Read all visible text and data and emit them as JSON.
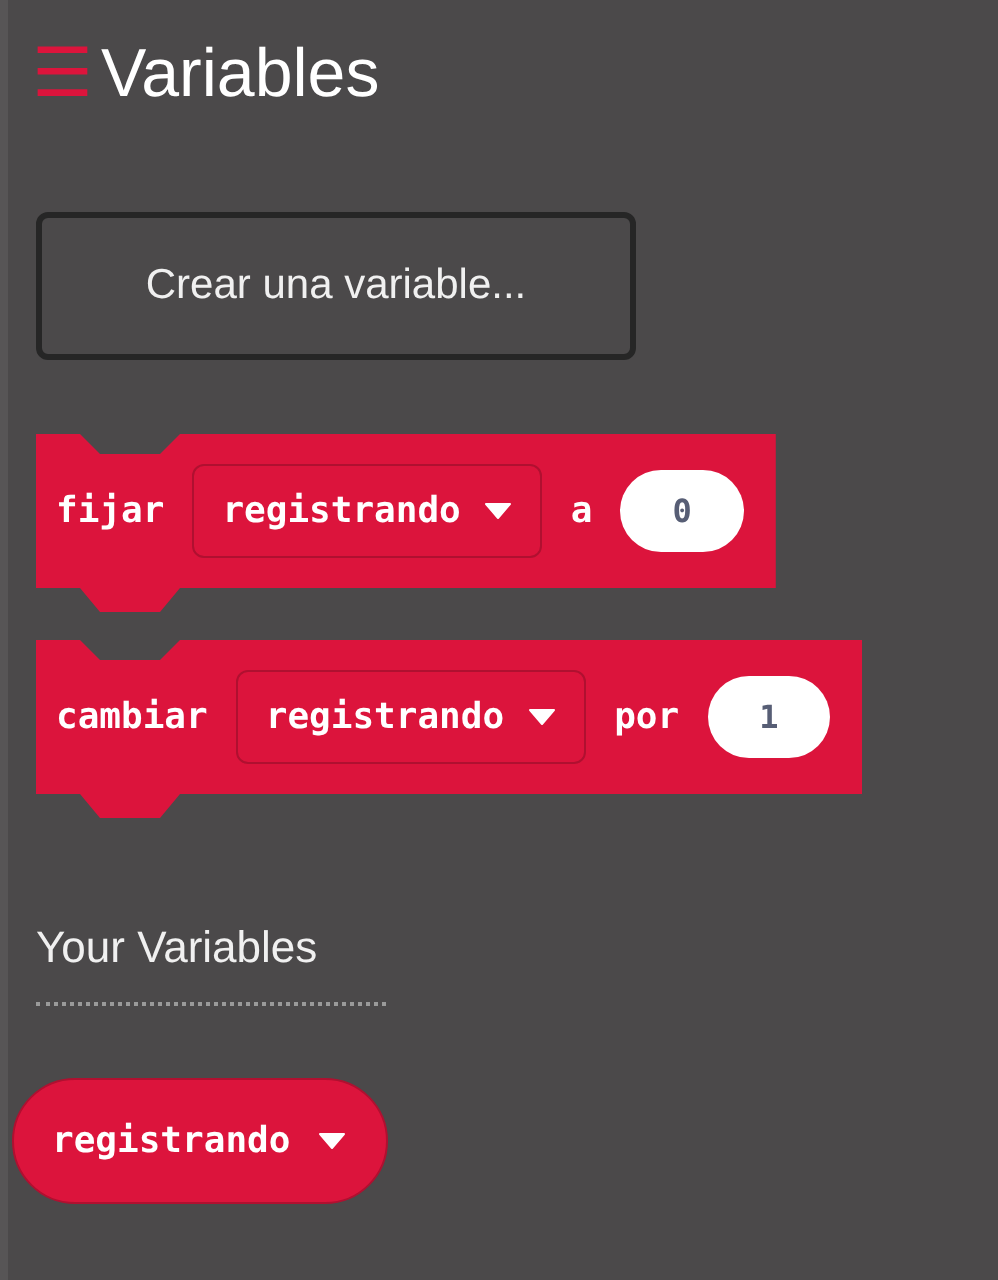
{
  "header": {
    "icon": "☰",
    "title": "Variables"
  },
  "create_button": {
    "label": "Crear una variable..."
  },
  "blocks": [
    {
      "parts": [
        {
          "kind": "label",
          "text": "fijar"
        },
        {
          "kind": "dropdown",
          "text": "registrando"
        },
        {
          "kind": "label",
          "text": "a"
        },
        {
          "kind": "number",
          "text": "0"
        }
      ]
    },
    {
      "parts": [
        {
          "kind": "label",
          "text": "cambiar"
        },
        {
          "kind": "dropdown",
          "text": "registrando"
        },
        {
          "kind": "label",
          "text": "por"
        },
        {
          "kind": "number",
          "text": "1"
        }
      ]
    }
  ],
  "your_variables": {
    "heading": "Your Variables",
    "items": [
      {
        "text": "registrando"
      }
    ]
  }
}
